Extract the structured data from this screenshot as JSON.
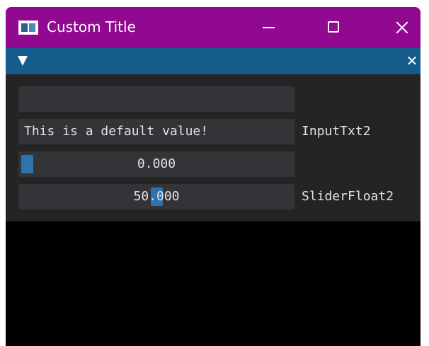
{
  "window": {
    "title": "Custom Title"
  },
  "imgui": {
    "input_text_1": {
      "value": ""
    },
    "input_text_2": {
      "value": "This is a default value!",
      "label": "InputTxt2"
    },
    "slider_float_1": {
      "value_text": "0.000",
      "fraction": 0
    },
    "slider_float_2": {
      "value_text": "50.000",
      "label": "SliderFloat2",
      "fraction": 0.5
    }
  },
  "colors": {
    "os_titlebar": "#910891",
    "imgui_titlebar": "#155b8c",
    "imgui_window_bg": "#242424",
    "frame_bg": "#333438",
    "slider_grab": "#2f73ad",
    "text": "#e2e2e2"
  }
}
